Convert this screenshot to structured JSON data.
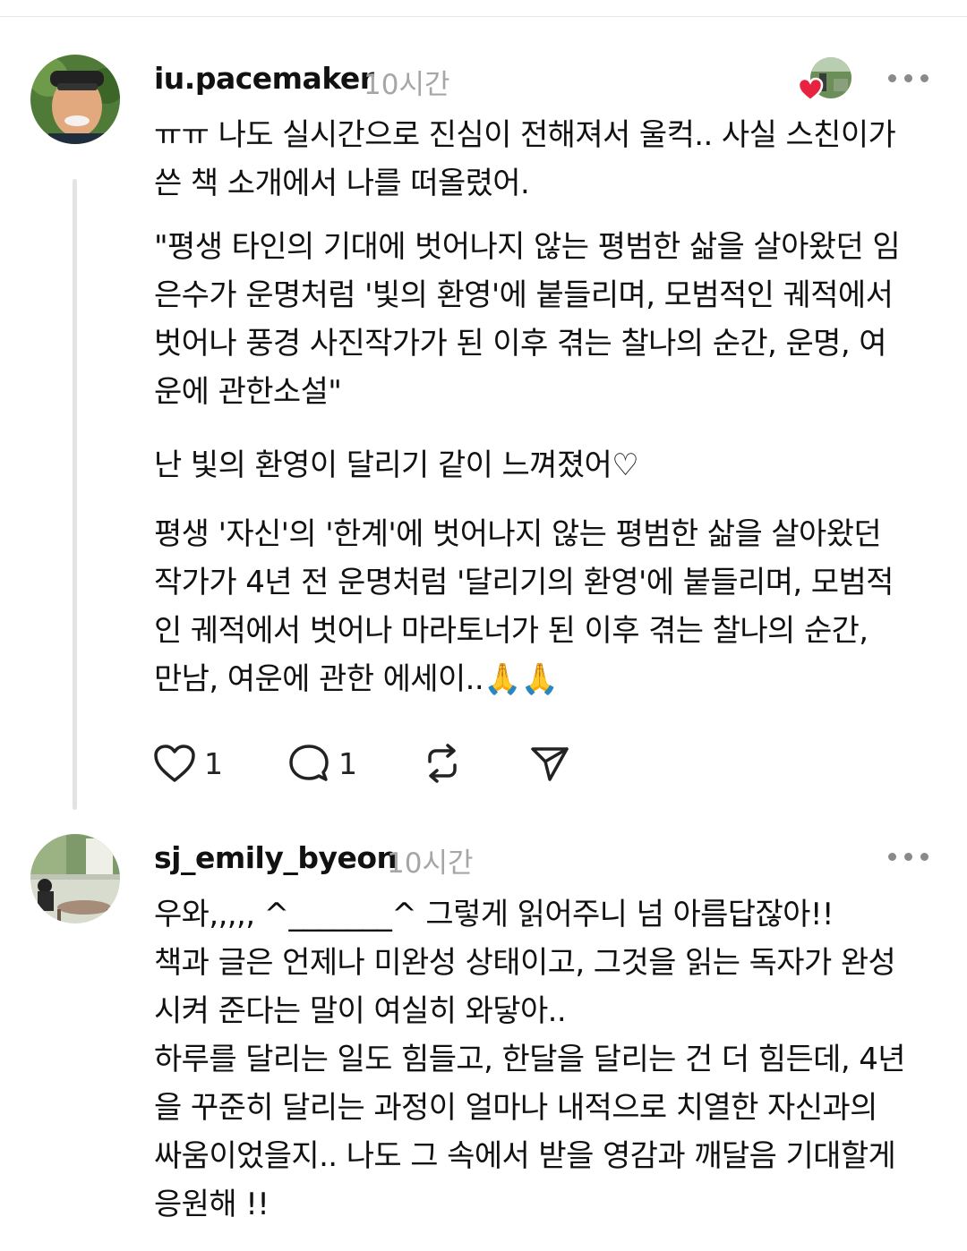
{
  "comments": [
    {
      "username": "iu.pacemaker",
      "time": "10시간",
      "paragraphs": [
        "ㅠㅠ 나도 실시간으로 진심이 전해져서 울컥.. 사실 스친이가\n쓴 책 소개에서 나를 떠올렸어.",
        "\"평생 타인의 기대에 벗어나지 않는 평범한 삶을 살아왔던 임\n은수가 운명처럼 '빛의 환영'에 붙들리며, 모범적인 궤적에서\n벗어나 풍경 사진작가가 된 이후 겪는 찰나의 순간, 운명, 여\n운에 관한소설\"",
        "난 빛의 환영이 달리기 같이 느껴졌어♡",
        "평생 '자신'의 '한계'에 벗어나지 않는 평범한 삶을 살아왔던\n작가가 4년 전 운명처럼 '달리기의 환영'에 붙들리며, 모범적\n인 궤적에서 벗어나 마라토너가 된 이후 겪는 찰나의 순간,\n만남, 여운에 관한 에세이..🙏🙏"
      ],
      "actions": {
        "like_count": "1",
        "reply_count": "1"
      },
      "liked_by_author": true
    },
    {
      "username": "sj_emily_byeon",
      "time": "10시간",
      "paragraphs": [
        "우와,,,,, ^_______^ 그렇게 읽어주니 넘 아름답잖아!!\n책과 글은 언제나 미완성 상태이고, 그것을 읽는 독자가 완성\n시켜 준다는 말이 여실히 와닿아..\n하루를 달리는 일도 힘들고, 한달을 달리는 건 더 힘든데, 4년\n을 꾸준히 달리는 과정이 얼마나 내적으로 치열한 자신과의\n싸움이었을지.. 나도 그 속에서 받을 영감과 깨달음 기대할게\n응원해 !!"
      ]
    }
  ],
  "colors": {
    "text": "#111111",
    "muted": "#a6a6a6",
    "icon": "#222222",
    "heart": "#e8233f"
  },
  "icons": [
    "heart-icon",
    "comment-icon",
    "repost-icon",
    "share-icon",
    "more-icon"
  ]
}
